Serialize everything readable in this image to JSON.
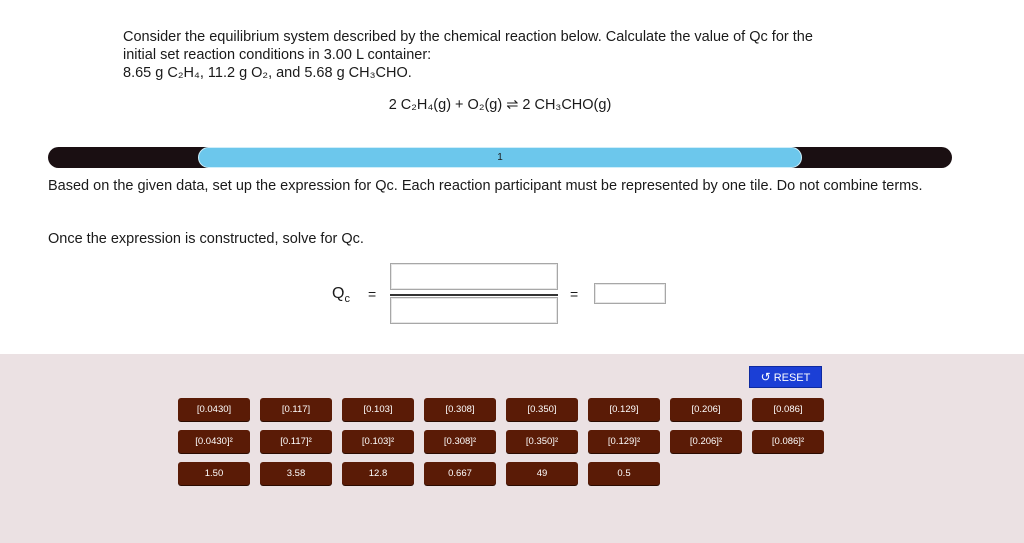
{
  "problem": {
    "line1": "Consider the equilibrium system described by the chemical reaction below. Calculate the value of Qc for the",
    "line2": "initial set reaction conditions in 3.00 L container:",
    "line3": "8.65 g C₂H₄, 11.2 g O₂, and 5.68 g CH₃CHO."
  },
  "equation": "2 C₂H₄(g) + O₂(g) ⇌ 2 CH₃CHO(g)",
  "progress": {
    "step_label": "1",
    "fill_fraction": 0.67
  },
  "instructions": {
    "text": "Based on the given data, set up the expression for Qc. Each reaction participant must be represented by one tile. Do not combine terms.",
    "solve": "Once the expression is constructed, solve for Qc."
  },
  "expression": {
    "qc_symbol": "Q",
    "qc_subscript": "c",
    "equals1": "=",
    "equals2": "="
  },
  "reset": {
    "label": "RESET",
    "icon": "undo-icon"
  },
  "tiles_row1": [
    "[0.0430]",
    "[0.117]",
    "[0.103]",
    "[0.308]",
    "[0.350]",
    "[0.129]",
    "[0.206]",
    "[0.086]"
  ],
  "tiles_row2": [
    "[0.0430]²",
    "[0.117]²",
    "[0.103]²",
    "[0.308]²",
    "[0.350]²",
    "[0.129]²",
    "[0.206]²",
    "[0.086]²"
  ],
  "tiles_row3": [
    "1.50",
    "3.58",
    "12.8",
    "0.667",
    "49",
    "0.5"
  ],
  "colors": {
    "tile_bg": "#5a1b06",
    "reset_bg": "#1b3fd6",
    "progress_fill": "#6cc7ec",
    "progress_track": "#1a0f12",
    "tray_bg": "#ebe1e3"
  }
}
